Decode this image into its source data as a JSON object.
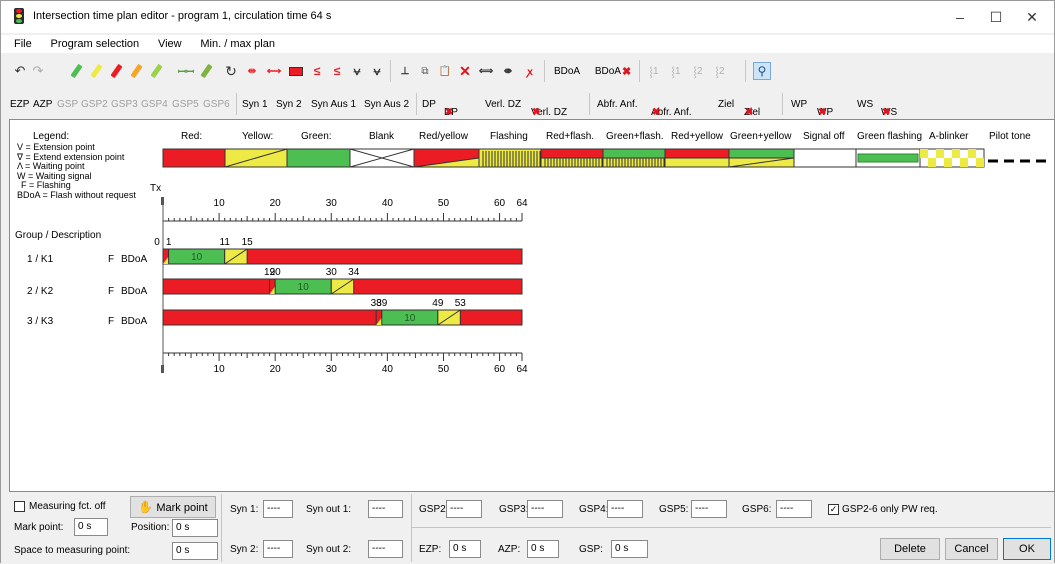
{
  "window": {
    "title": "Intersection time plan editor - program 1, circulation time 64 s",
    "minimize": "–",
    "maximize": "☐",
    "close": "✕"
  },
  "menu": [
    "File",
    "Program selection",
    "View",
    "Min. / max plan"
  ],
  "toolbar2": {
    "items": [
      "EZP",
      "AZP",
      "GSP",
      "GSP2",
      "GSP3",
      "GSP4",
      "GSP5",
      "GSP6",
      "Syn 1",
      "Syn 2",
      "Syn Aus 1",
      "Syn Aus 2",
      "DP",
      "DP",
      "Verl. DZ",
      "Verl. DZ",
      "Abfr. Anf.",
      "Abfr. Anf.",
      "Ziel",
      "Ziel",
      "WP",
      "WP",
      "WS",
      "WS"
    ]
  },
  "toolbar1": {
    "bdoa": "BDoA",
    "bdoa2": "BDoA",
    "phase_labels": [
      "1",
      "1",
      "2",
      "2"
    ]
  },
  "legend": {
    "title": "Legend:",
    "notes": [
      "V = Extension point",
      "∇ = Extend extension point",
      "Λ = Waiting point",
      "W = Waiting signal",
      "F = Flashing",
      "BDoA = Flash without request"
    ],
    "items": [
      "Red:",
      "Yellow:",
      "Green:",
      "Blank",
      "Red/yellow",
      "Flashing",
      "Red+flash.",
      "Green+flash.",
      "Red+yellow",
      "Green+yellow",
      "Signal off",
      "Green flashing",
      "A-blinker",
      "Pilot tone"
    ]
  },
  "colors": {
    "red": "#ec1c24",
    "yellow": "#eeea45",
    "green": "#4dbe52",
    "dark": "#333333"
  },
  "timeline": {
    "tx": "Tx",
    "ticks": [
      "0",
      "10",
      "20",
      "30",
      "40",
      "50",
      "60",
      "64"
    ],
    "max": 64
  },
  "groups_header": "Group / Description",
  "groups": [
    {
      "name": "1 / K1",
      "flag": "F",
      "mode": "BDoA",
      "green_start": 1,
      "yellow_start": 11,
      "yellow_end": 15,
      "green_label": "10",
      "marks": [
        "0",
        "1",
        "11",
        "15"
      ],
      "mark_values": [
        0,
        1,
        11,
        15
      ]
    },
    {
      "name": "2 / K2",
      "flag": "F",
      "mode": "BDoA",
      "green_start": 20,
      "yellow_start": 30,
      "yellow_end": 34,
      "green_label": "10",
      "marks": [
        "19",
        "20",
        "30",
        "34"
      ],
      "mark_values": [
        19,
        20,
        30,
        34
      ]
    },
    {
      "name": "3 / K3",
      "flag": "F",
      "mode": "BDoA",
      "green_start": 39,
      "yellow_start": 49,
      "yellow_end": 53,
      "green_label": "10",
      "marks": [
        "38",
        "39",
        "49",
        "53"
      ],
      "mark_values": [
        38,
        39,
        49,
        53
      ]
    }
  ],
  "bottom": {
    "measuring": "Measuring fct. off",
    "mark_point_btn": "Mark point",
    "mark_point_label": "Mark point:",
    "mark_point_value": "0 s",
    "position_label": "Position:",
    "position_value": "0 s",
    "space_label": "Space to measuring point:",
    "space_value": "0 s",
    "syn1": "Syn 1:",
    "syn1_v": "----",
    "synout1": "Syn out 1:",
    "synout1_v": "----",
    "syn2": "Syn 2:",
    "syn2_v": "----",
    "synout2": "Syn out 2:",
    "synout2_v": "----",
    "gsp2": "GSP2:",
    "gsp2_v": "----",
    "gsp3": "GSP3:",
    "gsp3_v": "----",
    "gsp4": "GSP4:",
    "gsp4_v": "----",
    "gsp5": "GSP5:",
    "gsp5_v": "----",
    "gsp6": "GSP6:",
    "gsp6_v": "----",
    "gsp_only": "GSP2-6 only PW req.",
    "ezp": "EZP:",
    "ezp_v": "0 s",
    "azp": "AZP:",
    "azp_v": "0 s",
    "gsp": "GSP:",
    "gsp_v": "0 s",
    "delete": "Delete",
    "cancel": "Cancel",
    "ok": "OK"
  }
}
